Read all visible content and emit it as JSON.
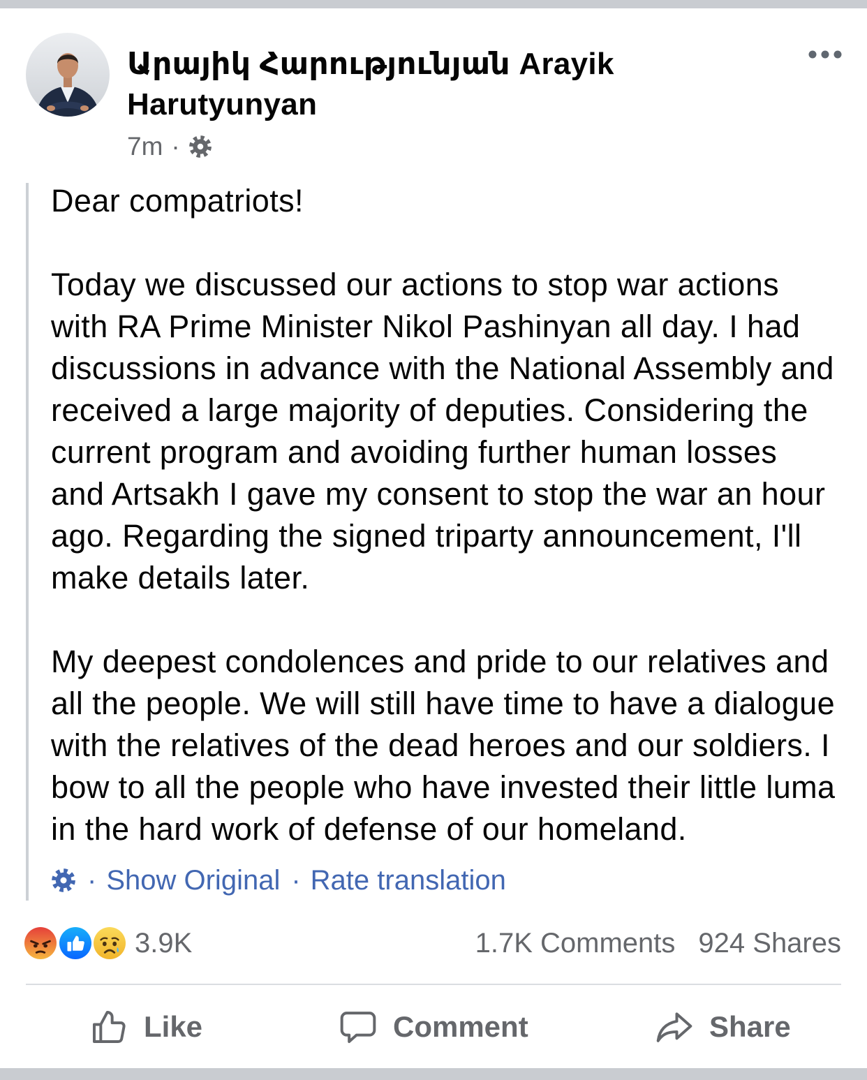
{
  "post": {
    "author": "Արայիկ Հարությունյան Arayik Harutyunyan",
    "time": "7m",
    "separator": "·",
    "privacy_icon": "gear-icon",
    "more_icon": "more-dots-icon",
    "avatar_icon": "profile-photo"
  },
  "body": {
    "paragraphs": [
      [
        "Dear compatriots!"
      ],
      [
        "Today we discussed our actions to stop war actions",
        "with RA Prime Minister Nikol Pashinyan all day. I had",
        "discussions in advance with the National Assembly and",
        "received a large majority of deputies. Considering the",
        "current program and avoiding further human losses",
        "and Artsakh I gave my consent to stop the war an hour",
        "ago. Regarding the signed triparty announcement, I'll",
        "make details later."
      ],
      [
        "My deepest condolences and pride to our relatives and",
        "all the people. We will still have time to have a dialogue",
        "with the relatives of the dead heroes and our soldiers. I",
        "bow to all the people who have invested their little luma",
        "in the hard work of defense of our homeland."
      ]
    ]
  },
  "translation": {
    "settings_icon": "gear-icon",
    "separator": "·",
    "show_original": "Show Original",
    "rate_translation": "Rate translation"
  },
  "stats": {
    "reaction_icons": [
      "angry-reaction-icon",
      "like-reaction-icon",
      "sad-reaction-icon"
    ],
    "reaction_count": "3.9K",
    "comments": "1.7K Comments",
    "shares": "924 Shares"
  },
  "actions": {
    "like": {
      "label": "Like",
      "icon": "thumbs-up-icon"
    },
    "comment": {
      "label": "Comment",
      "icon": "comment-bubble-icon"
    },
    "share": {
      "label": "Share",
      "icon": "share-arrow-icon"
    }
  },
  "colors": {
    "text": "#050505",
    "secondary": "#65676b",
    "link": "#4267b2",
    "divider": "#dadde1",
    "background_band": "#c9ccd1"
  }
}
